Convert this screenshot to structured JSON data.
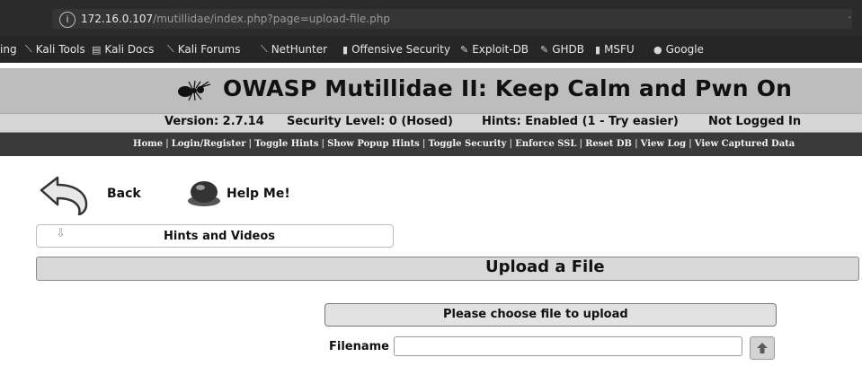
{
  "browser": {
    "url_host": "172.16.0.107",
    "url_path": "/mutillidae/index.php?page=upload-file.php",
    "url_info_glyph": "i",
    "menu_glyph": "·",
    "bookmarks": [
      {
        "label": "ing",
        "icon": "truncated"
      },
      {
        "label": "Kali Tools",
        "icon": "kali-dragon-icon"
      },
      {
        "label": "Kali Docs",
        "icon": "kali-docs-icon"
      },
      {
        "label": "Kali Forums",
        "icon": "kali-dragon-icon"
      },
      {
        "label": "NetHunter",
        "icon": "kali-dragon-icon"
      },
      {
        "label": "Offensive Security",
        "icon": "offsec-icon"
      },
      {
        "label": "Exploit-DB",
        "icon": "exploit-db-icon"
      },
      {
        "label": "GHDB",
        "icon": "ghdb-icon"
      },
      {
        "label": "MSFU",
        "icon": "msfu-icon"
      },
      {
        "label": "Google",
        "icon": "google-icon"
      }
    ]
  },
  "header": {
    "title": "OWASP Mutillidae II: Keep Calm and Pwn On",
    "version": "Version: 2.7.14",
    "security_level": "Security Level: 0 (Hosed)",
    "hints": "Hints: Enabled (1 - Try easier)",
    "login_status": "Not Logged In"
  },
  "nav": {
    "items": [
      "Home",
      "Login/Register",
      "Toggle Hints",
      "Show Popup Hints",
      "Toggle Security",
      "Enforce SSL",
      "Reset DB",
      "View Log",
      "View Captured Data"
    ],
    "separator": "|"
  },
  "content": {
    "back_label": "Back",
    "help_label": "Help Me!",
    "hints_label": "Hints and Videos",
    "hints_arrow": "⇩",
    "page_heading": "Upload a File",
    "choose_heading": "Please choose file to upload",
    "filename_label": "Filename",
    "filename_value": ""
  },
  "colors": {
    "logo_bar": "#bdbdbd",
    "nav_bar": "#3a3a3a",
    "upload_bar": "#d8d8d8"
  }
}
